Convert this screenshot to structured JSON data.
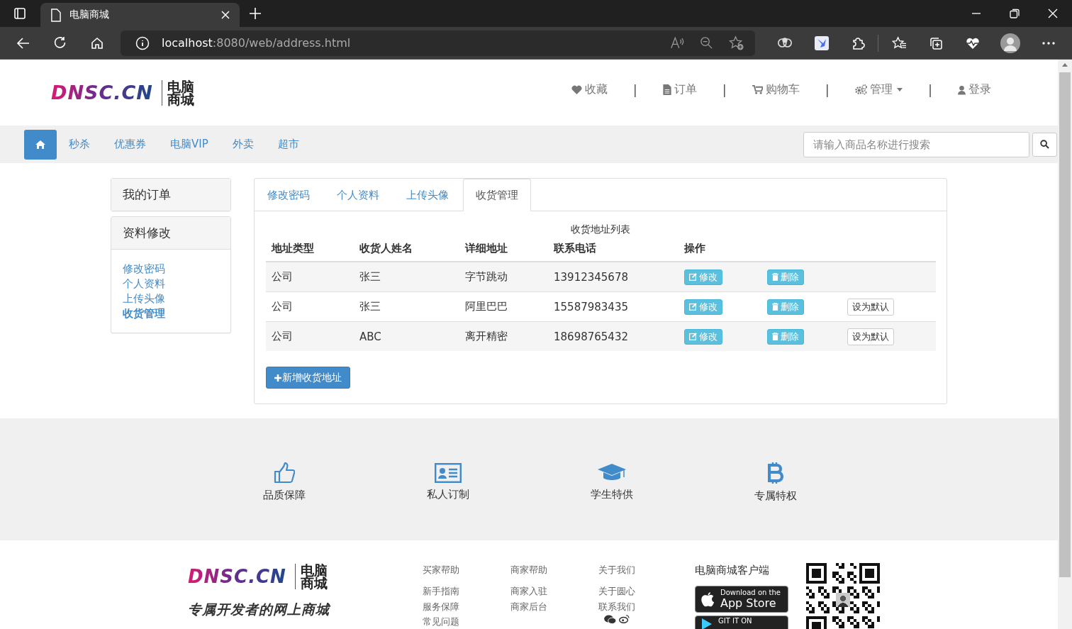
{
  "browser": {
    "tab_title": "电脑商城",
    "url_host": "localhost",
    "url_rest": ":8080/web/address.html"
  },
  "header": {
    "logo": {
      "brand": "DNSC.CN",
      "name_lines": [
        "电脑",
        "商城"
      ]
    },
    "top_links": [
      {
        "kind": "heart",
        "label": "收藏",
        "dropdown": false
      },
      {
        "kind": "divider",
        "label": "|"
      },
      {
        "kind": "file",
        "label": "订单",
        "dropdown": false
      },
      {
        "kind": "divider",
        "label": "|"
      },
      {
        "kind": "cart",
        "label": "购物车",
        "dropdown": false
      },
      {
        "kind": "divider",
        "label": "|"
      },
      {
        "kind": "cogs",
        "label": "管理",
        "dropdown": true
      },
      {
        "kind": "divider",
        "label": "|"
      },
      {
        "kind": "user",
        "label": "登录",
        "dropdown": false
      }
    ]
  },
  "nav": {
    "links": [
      "秒杀",
      "优惠券",
      "电脑VIP",
      "外卖",
      "超市"
    ],
    "search": {
      "placeholder": "请输入商品名称进行搜索"
    }
  },
  "sidebar": [
    {
      "title": "我的订单"
    },
    {
      "title": "资料修改",
      "items": [
        {
          "label": "修改密码",
          "selected": false
        },
        {
          "label": "个人资料",
          "selected": false
        },
        {
          "label": "上传头像",
          "selected": false
        },
        {
          "label": "收货管理",
          "selected": true
        }
      ]
    }
  ],
  "tabs": [
    {
      "label": "修改密码",
      "selected": false
    },
    {
      "label": "个人资料",
      "selected": false
    },
    {
      "label": "上传头像",
      "selected": false
    },
    {
      "label": "收货管理",
      "selected": true
    }
  ],
  "address_table": {
    "caption": "收货地址列表",
    "columns": [
      "地址类型",
      "收货人姓名",
      "详细地址",
      "联系电话",
      "操作"
    ],
    "rows": [
      {
        "type": "公司",
        "name": "张三",
        "address": "字节跳动",
        "phone": "13912345678",
        "edit": "修改",
        "delete": "删除"
      },
      {
        "type": "公司",
        "name": "张三",
        "address": "阿里巴巴",
        "phone": "15587983435",
        "edit": "修改",
        "delete": "删除",
        "set_default": "设为默认"
      },
      {
        "type": "公司",
        "name": "ABC",
        "address": "离开精密",
        "phone": "18698765432",
        "edit": "修改",
        "delete": "删除",
        "set_default": "设为默认"
      }
    ]
  },
  "add_button": "新增收货地址",
  "features": [
    {
      "kind": "thumbs-up",
      "label": "品质保障"
    },
    {
      "kind": "id-card",
      "label": "私人订制"
    },
    {
      "kind": "graduation-cap",
      "label": "学生特供"
    },
    {
      "kind": "bitcoin",
      "label": "专属特权"
    }
  ],
  "footer": {
    "logo": {
      "brand": "DNSC.CN",
      "name_lines": [
        "电脑",
        "商城"
      ]
    },
    "slogan": "专属开发者的网上商城",
    "columns": [
      {
        "title": "买家帮助",
        "links": [
          "新手指南",
          "服务保障",
          "常见问题"
        ]
      },
      {
        "title": "商家帮助",
        "links": [
          "商家入驻",
          "商家后台"
        ]
      },
      {
        "title": "关于我们",
        "links": [
          "关于圆心",
          "联系我们"
        ],
        "social_icons": true
      }
    ],
    "app": {
      "title": "电脑商城客户端",
      "badges": [
        {
          "kind": "apple",
          "small": "Download on the",
          "big": "App Store"
        },
        {
          "kind": "play",
          "small": "GIT IT ON"
        }
      ]
    }
  }
}
